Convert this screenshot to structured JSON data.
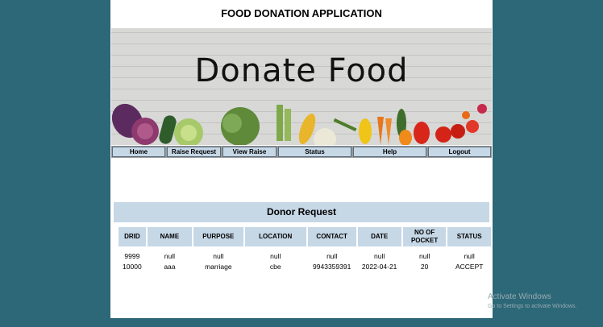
{
  "app": {
    "title": "FOOD DONATION APPLICATION"
  },
  "banner": {
    "text": "Donate Food"
  },
  "nav": {
    "items": [
      {
        "label": "Home"
      },
      {
        "label": "Raise Request"
      },
      {
        "label": "View Raise"
      },
      {
        "label": "Status"
      },
      {
        "label": "Help"
      },
      {
        "label": "Logout"
      }
    ]
  },
  "section": {
    "title": "Donor Request"
  },
  "table": {
    "columns": [
      "DRID",
      "NAME",
      "PURPOSE",
      "LOCATION",
      "CONTACT",
      "DATE",
      "NO OF POCKET",
      "STATUS"
    ],
    "rows": [
      [
        "9999",
        "null",
        "null",
        "null",
        "null",
        "null",
        "null",
        "null"
      ],
      [
        "10000",
        "aaa",
        "marriage",
        "cbe",
        "9943359391",
        "2022-04-21",
        "20",
        "ACCEPT"
      ]
    ]
  },
  "watermark": {
    "title": "Activate Windows",
    "subtitle": "Go to Settings to activate Windows."
  },
  "colors": {
    "background": "#2c6878",
    "nav_button": "#c6d7e6",
    "header_fill": "#c6d7e6"
  }
}
